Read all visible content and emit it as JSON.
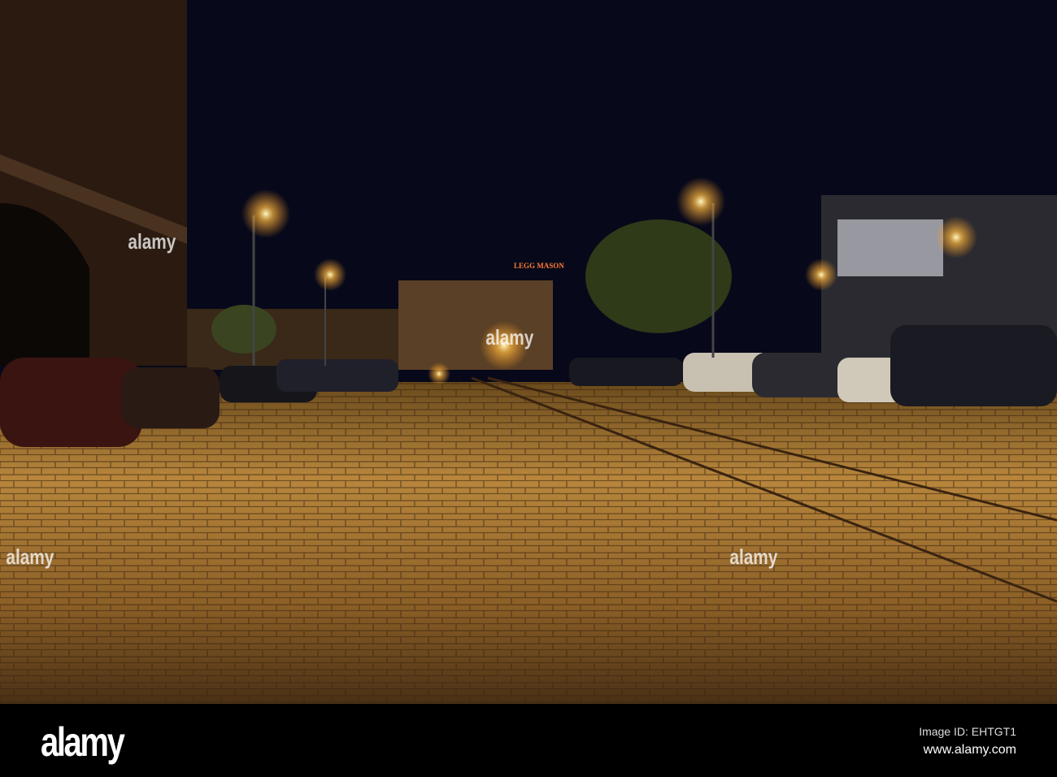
{
  "photo": {
    "sign_text": "LEGG MASON",
    "watermark": "alamy"
  },
  "footer": {
    "logo": "alamy",
    "image_id": "Image ID: EHTGT1",
    "url": "www.alamy.com"
  }
}
